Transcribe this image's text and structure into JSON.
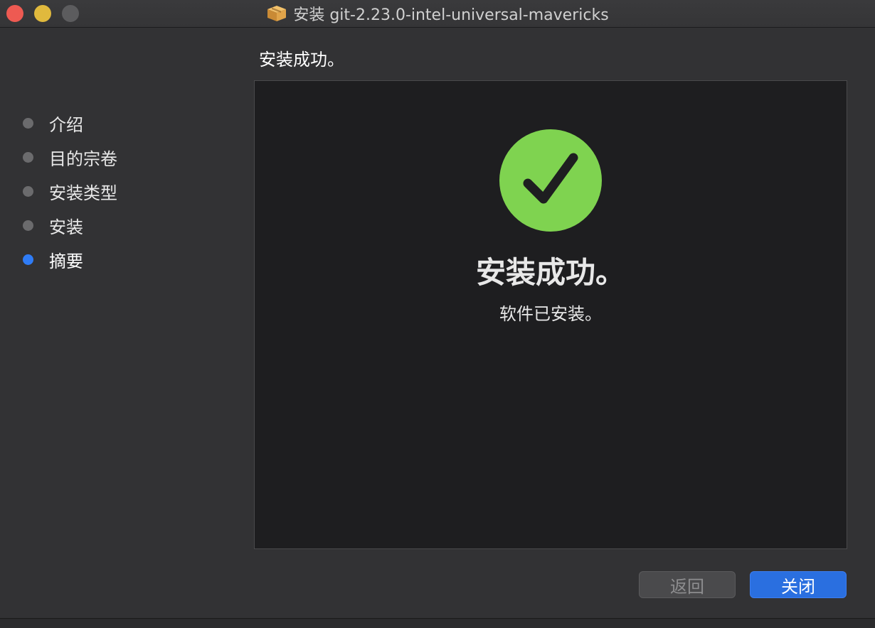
{
  "window": {
    "title": "安装 git-2.23.0-intel-universal-mavericks"
  },
  "sidebar": {
    "steps": [
      {
        "label": "介绍",
        "active": false
      },
      {
        "label": "目的宗卷",
        "active": false
      },
      {
        "label": "安装类型",
        "active": false
      },
      {
        "label": "安装",
        "active": false
      },
      {
        "label": "摘要",
        "active": true
      }
    ]
  },
  "main": {
    "heading": "安装成功。",
    "result_title": "安装成功。",
    "result_subtitle": "软件已安装。"
  },
  "buttons": {
    "back_label": "返回",
    "close_label": "关闭"
  },
  "colors": {
    "accent": "#2a6fe0",
    "success": "#7fd350",
    "active_step": "#2f7cf6"
  }
}
